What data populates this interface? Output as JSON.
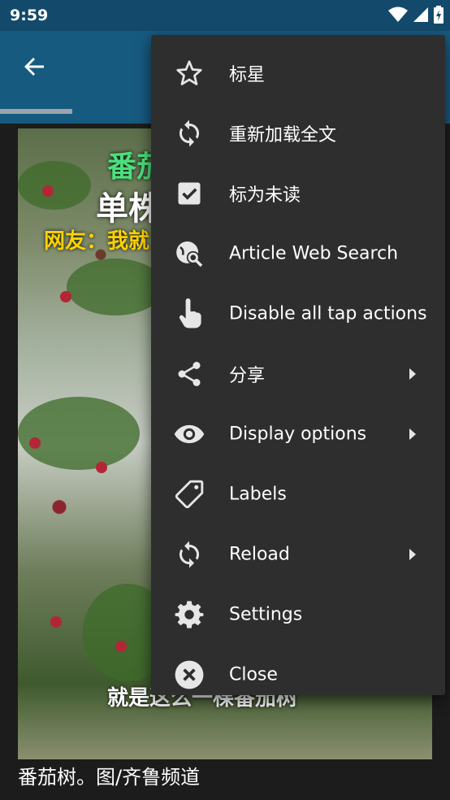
{
  "status": {
    "time": "9:59"
  },
  "article": {
    "caption": "番茄树。图/齐鲁频道",
    "overlay_top": "番茄",
    "overlay_title": "单株",
    "overlay_netizen": "网友：我就",
    "overlay_bottom": "就是这么一棵番茄树"
  },
  "menu": {
    "items": [
      {
        "label": "标星",
        "icon": "star-outline-icon",
        "has_submenu": false
      },
      {
        "label": "重新加载全文",
        "icon": "sync-icon",
        "has_submenu": false
      },
      {
        "label": "标为未读",
        "icon": "checkbox-checked-icon",
        "has_submenu": false
      },
      {
        "label": "Article Web Search",
        "icon": "web-search-icon",
        "has_submenu": false
      },
      {
        "label": "Disable all tap actions",
        "icon": "hand-tap-icon",
        "has_submenu": false
      },
      {
        "label": "分享",
        "icon": "share-icon",
        "has_submenu": true
      },
      {
        "label": "Display options",
        "icon": "eye-icon",
        "has_submenu": true
      },
      {
        "label": "Labels",
        "icon": "label-tag-icon",
        "has_submenu": false
      },
      {
        "label": "Reload",
        "icon": "reload-icon",
        "has_submenu": true
      },
      {
        "label": "Settings",
        "icon": "gear-icon",
        "has_submenu": false
      },
      {
        "label": "Close",
        "icon": "close-circle-icon",
        "has_submenu": false
      }
    ]
  },
  "colors": {
    "status_bar": "#134a6b",
    "app_bar": "#175a80",
    "menu_bg": "#2e2e2e",
    "icon": "#e6e6e6"
  },
  "reading_progress": 0.16
}
